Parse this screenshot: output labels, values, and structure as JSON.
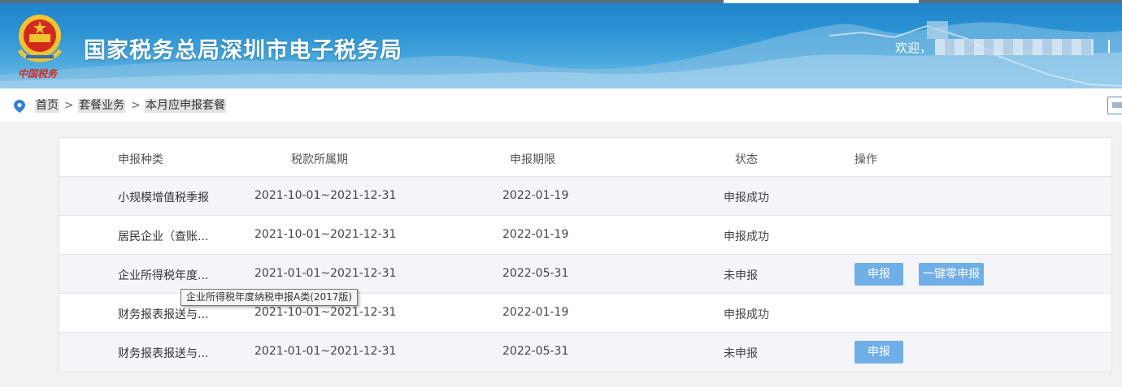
{
  "header": {
    "site_title": "国家税务总局深圳市电子税务局",
    "brand_script": "中国税务",
    "welcome": "欢迎，",
    "emblem_icon": "tax-emblem-icon"
  },
  "breadcrumb": {
    "icon": "location-pin-icon",
    "separator": ">",
    "items": [
      "首页",
      "套餐业务",
      "本月应申报套餐"
    ]
  },
  "table": {
    "headers": [
      "申报种类",
      "税款所属期",
      "申报期限",
      "状态",
      "操作"
    ],
    "rows": [
      {
        "name": "小规模增值税季报",
        "period": "2021-10-01~2021-12-31",
        "deadline": "2022-01-19",
        "status": "申报成功",
        "actions": []
      },
      {
        "name": "居民企业（查账...",
        "period": "2021-10-01~2021-12-31",
        "deadline": "2022-01-19",
        "status": "申报成功",
        "actions": []
      },
      {
        "name": "企业所得税年度...",
        "period": "2021-01-01~2021-12-31",
        "deadline": "2022-05-31",
        "status": "未申报",
        "actions": [
          "申报",
          "一键零申报"
        ]
      },
      {
        "name": "财务报表报送与...",
        "period": "2021-10-01~2021-12-31",
        "deadline": "2022-01-19",
        "status": "申报成功",
        "actions": []
      },
      {
        "name": "财务报表报送与...",
        "period": "2021-01-01~2021-12-31",
        "deadline": "2022-05-31",
        "status": "未申报",
        "actions": [
          "申报"
        ]
      }
    ]
  },
  "tooltip": "企业所得税年度纳税申报A类(2017版)",
  "colors": {
    "header_blue": "#2b92d3",
    "button_blue": "#70aee8",
    "row_alt": "#f3f5f8",
    "emblem_red": "#d32a1f",
    "emblem_gold": "#f2c230"
  }
}
